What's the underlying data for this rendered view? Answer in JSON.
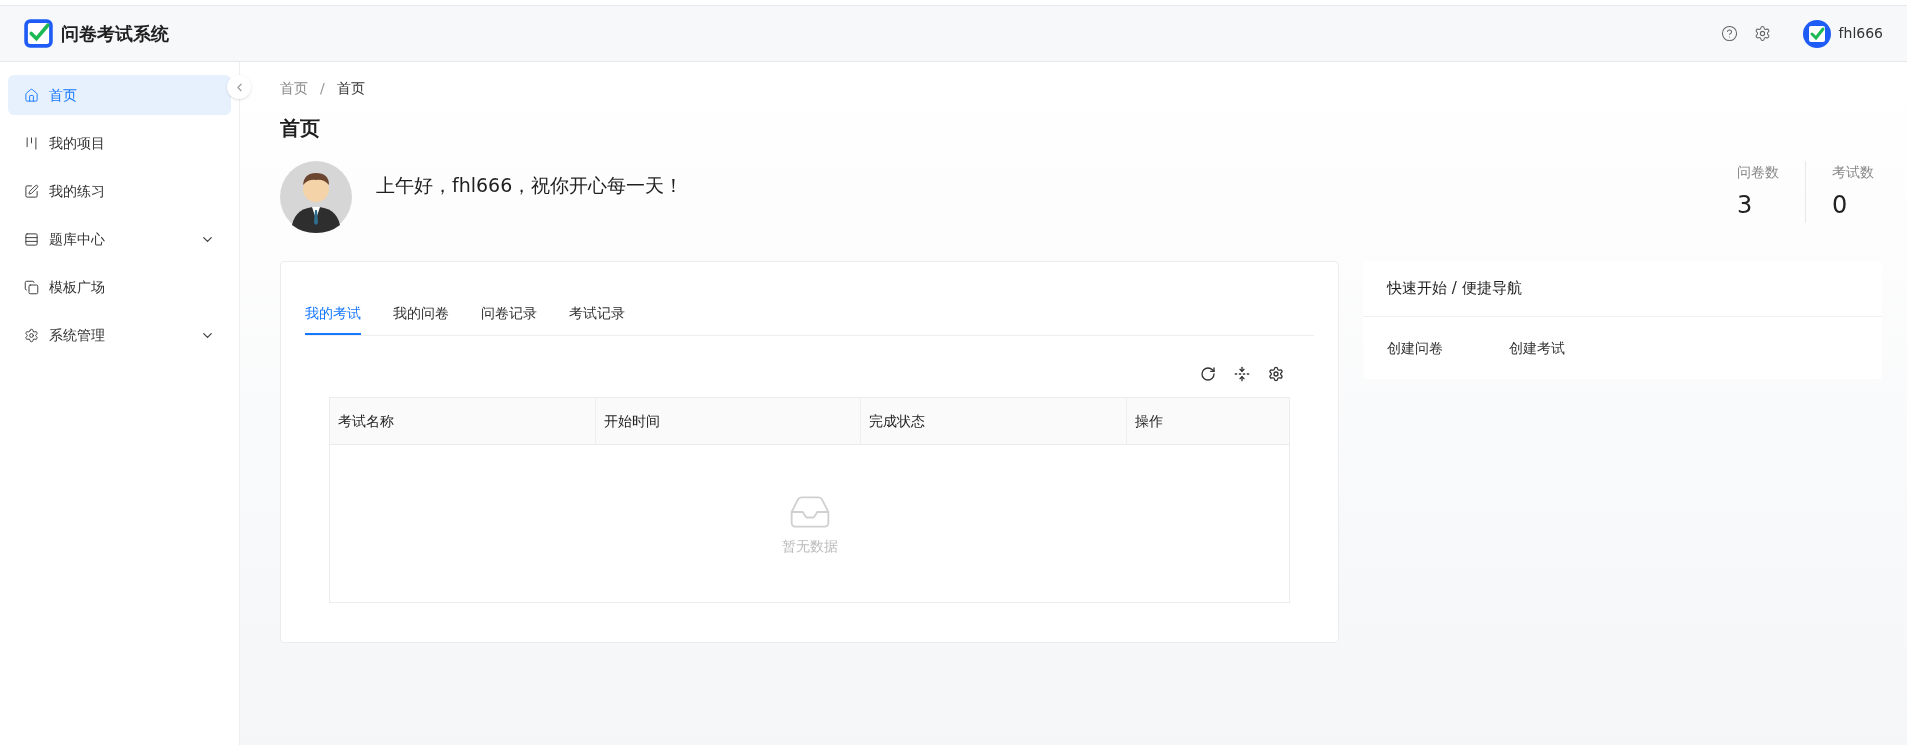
{
  "header": {
    "app_title": "问卷考试系统",
    "user_name": "fhl666"
  },
  "sidebar": {
    "items": [
      {
        "label": "首页",
        "selected": true,
        "has_submenu": false
      },
      {
        "label": "我的项目",
        "selected": false,
        "has_submenu": false
      },
      {
        "label": "我的练习",
        "selected": false,
        "has_submenu": false
      },
      {
        "label": "题库中心",
        "selected": false,
        "has_submenu": true
      },
      {
        "label": "模板广场",
        "selected": false,
        "has_submenu": false
      },
      {
        "label": "系统管理",
        "selected": false,
        "has_submenu": true
      }
    ]
  },
  "breadcrumb": {
    "items": [
      "首页",
      "首页"
    ],
    "separator": "/"
  },
  "page_title": "首页",
  "greeting": "上午好，fhl666，祝你开心每一天！",
  "stats": [
    {
      "label": "问卷数",
      "value": "3"
    },
    {
      "label": "考试数",
      "value": "0"
    }
  ],
  "tabs": [
    {
      "label": "我的考试",
      "selected": true
    },
    {
      "label": "我的问卷",
      "selected": false
    },
    {
      "label": "问卷记录",
      "selected": false
    },
    {
      "label": "考试记录",
      "selected": false
    }
  ],
  "table": {
    "columns": [
      "考试名称",
      "开始时间",
      "完成状态",
      "操作"
    ],
    "empty_text": "暂无数据"
  },
  "quick_nav": {
    "title": "快速开始 / 便捷导航",
    "links": [
      "创建问卷",
      "创建考试"
    ]
  }
}
